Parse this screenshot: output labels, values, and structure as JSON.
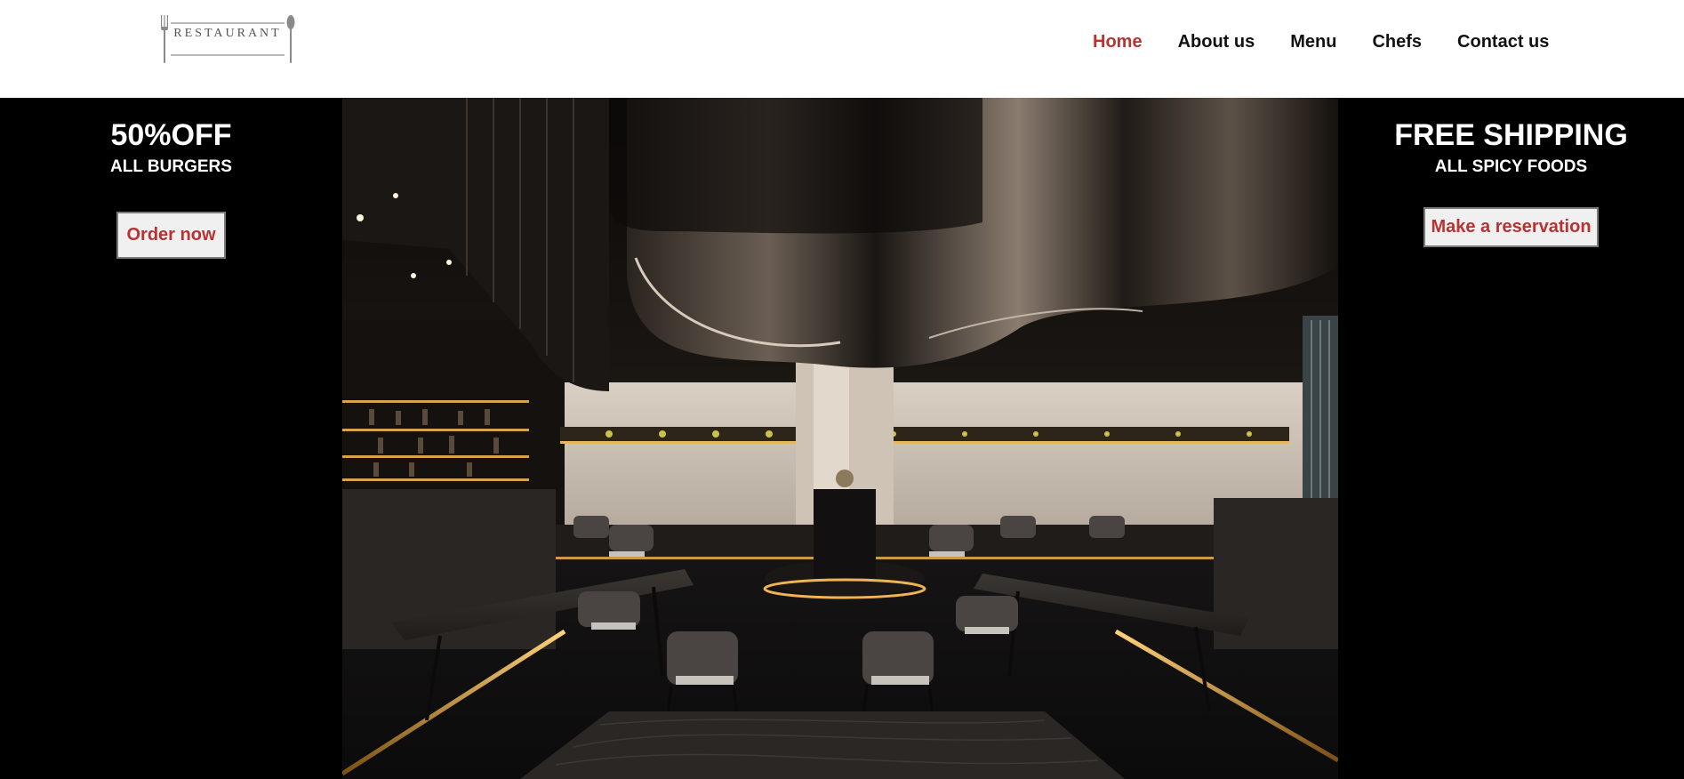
{
  "header": {
    "logo_text": "RESTAURANT",
    "nav": [
      {
        "label": "Home",
        "active": true
      },
      {
        "label": "About us",
        "active": false
      },
      {
        "label": "Menu",
        "active": false
      },
      {
        "label": "Chefs",
        "active": false
      },
      {
        "label": "Contact us",
        "active": false
      }
    ]
  },
  "hero": {
    "left_promo": {
      "title": "50%OFF",
      "subtitle": "ALL BURGERS",
      "button_label": "Order now"
    },
    "right_promo": {
      "title": "FREE SHIPPING",
      "subtitle": "ALL SPICY FOODS",
      "button_label": "Make a reservation"
    },
    "image_description_icon": "restaurant-interior-photo"
  },
  "colors": {
    "accent": "#b83232",
    "nav_text": "#111111",
    "hero_background": "#000000",
    "button_background": "#f0f0f0"
  }
}
